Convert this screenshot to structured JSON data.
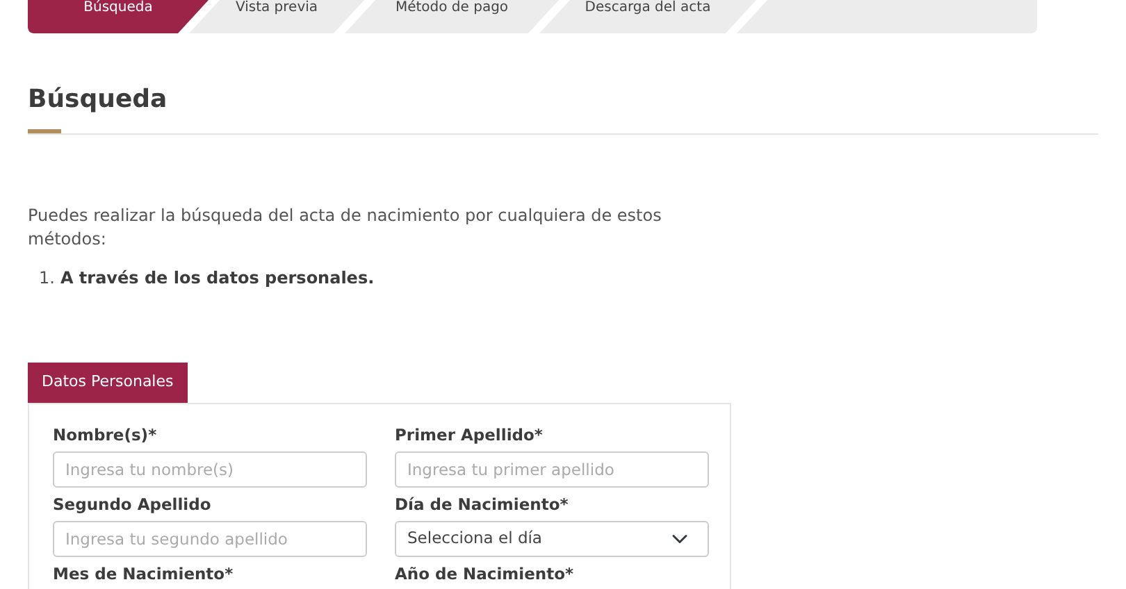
{
  "steps": [
    {
      "label": "Búsqueda",
      "selected": true
    },
    {
      "label": "Vista previa",
      "selected": false
    },
    {
      "label": "Método de pago",
      "selected": false
    },
    {
      "label": "Descarga del acta",
      "selected": false
    }
  ],
  "heading": "Búsqueda",
  "intro": "Puedes realizar la búsqueda del acta de nacimiento por cualquiera de estos métodos:",
  "methods": [
    {
      "number": "1.",
      "text": "A través de los datos personales."
    }
  ],
  "form_tabs": [
    {
      "label": "Datos Personales",
      "selected": true
    }
  ],
  "fields": [
    {
      "kind": "text",
      "label": "Nombre(s)*",
      "placeholder": "Ingresa tu nombre(s)"
    },
    {
      "kind": "text",
      "label": "Primer Apellido*",
      "placeholder": "Ingresa tu primer apellido"
    },
    {
      "kind": "text",
      "label": "Segundo Apellido",
      "placeholder": "Ingresa tu segundo apellido"
    },
    {
      "kind": "select",
      "label": "Día de Nacimiento*",
      "value": "Selecciona el día"
    },
    {
      "kind": "label",
      "label": "Mes de Nacimiento*"
    },
    {
      "kind": "label",
      "label": "Año de Nacimiento*"
    }
  ]
}
